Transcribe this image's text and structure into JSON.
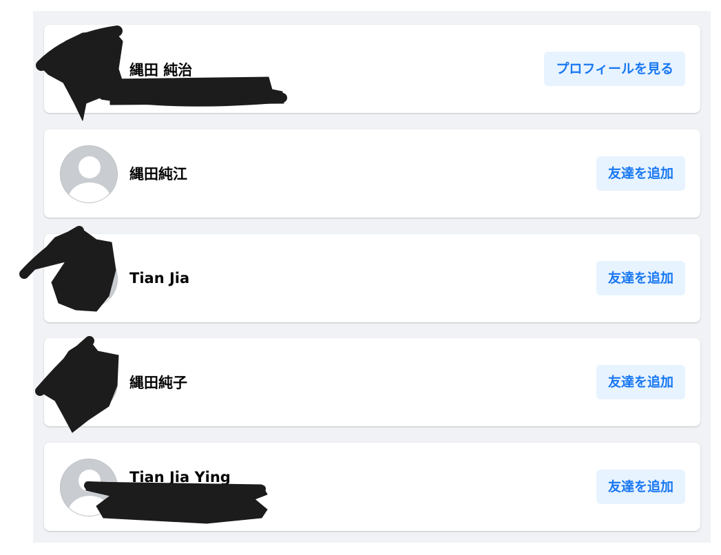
{
  "results": [
    {
      "name": "縄田 純治",
      "action_label": "プロフィールを見る"
    },
    {
      "name": "縄田純江",
      "action_label": "友達を追加"
    },
    {
      "name": "Tian Jia",
      "action_label": "友達を追加"
    },
    {
      "name": "縄田純子",
      "action_label": "友達を追加"
    },
    {
      "name": "Tian Jia Ying",
      "action_label": "友達を追加"
    }
  ],
  "colors": {
    "background": "#f0f2f5",
    "button_bg": "#e7f3ff",
    "button_text": "#1877f2",
    "redaction": "#1c1c1c"
  },
  "icons": {
    "default_avatar": "person-silhouette-icon"
  }
}
